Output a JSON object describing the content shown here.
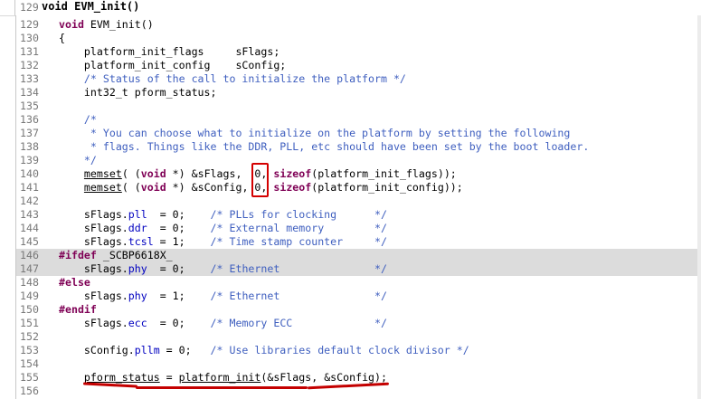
{
  "header": {
    "line_number": "129",
    "text": "void EVM_init()"
  },
  "lines": [
    {
      "n": "129",
      "code": "void EVM_init()"
    },
    {
      "n": "130",
      "code": "{"
    },
    {
      "n": "131",
      "code": "    platform_init_flags     sFlags;"
    },
    {
      "n": "132",
      "code": "    platform_init_config    sConfig;"
    },
    {
      "n": "133",
      "code": "    /* Status of the call to initialize the platform */"
    },
    {
      "n": "134",
      "code": "    int32_t pform_status;"
    },
    {
      "n": "135",
      "code": ""
    },
    {
      "n": "136",
      "code": "    /*"
    },
    {
      "n": "137",
      "code": "     * You can choose what to initialize on the platform by setting the following"
    },
    {
      "n": "138",
      "code": "     * flags. Things like the DDR, PLL, etc should have been set by the boot loader."
    },
    {
      "n": "139",
      "code": "    */"
    },
    {
      "n": "140",
      "code": "    memset( (void *) &sFlags,  0, sizeof(platform_init_flags));"
    },
    {
      "n": "141",
      "code": "    memset( (void *) &sConfig, 0, sizeof(platform_init_config));"
    },
    {
      "n": "142",
      "code": ""
    },
    {
      "n": "143",
      "code": "    sFlags.pll  = 0;    /* PLLs for clocking      */"
    },
    {
      "n": "144",
      "code": "    sFlags.ddr  = 0;    /* External memory        */"
    },
    {
      "n": "145",
      "code": "    sFlags.tcsl = 1;    /* Time stamp counter     */"
    },
    {
      "n": "146",
      "code": "#ifdef _SCBP6618X_"
    },
    {
      "n": "147",
      "code": "    sFlags.phy  = 0;    /* Ethernet               */"
    },
    {
      "n": "148",
      "code": "#else"
    },
    {
      "n": "149",
      "code": "    sFlags.phy  = 1;    /* Ethernet               */"
    },
    {
      "n": "150",
      "code": "#endif"
    },
    {
      "n": "151",
      "code": "    sFlags.ecc  = 0;    /* Memory ECC             */"
    },
    {
      "n": "152",
      "code": ""
    },
    {
      "n": "153",
      "code": "    sConfig.pllm = 0;   /* Use libraries default clock divisor */"
    },
    {
      "n": "154",
      "code": ""
    },
    {
      "n": "155",
      "code": "    pform_status = platform_init(&sFlags, &sConfig);"
    },
    {
      "n": "156",
      "code": ""
    }
  ],
  "colors": {
    "keyword": "#7f0055",
    "comment": "#3f5fbf",
    "field": "#0000c0",
    "highlight": "#dcdcdc",
    "annotation": "#d40000"
  }
}
